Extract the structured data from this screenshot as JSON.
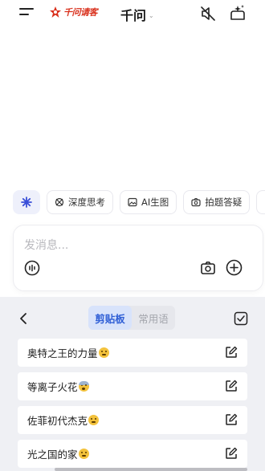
{
  "header": {
    "brand_text": "千问请客",
    "title": "千问",
    "title_caret": "⌄"
  },
  "chips": [
    {
      "icon": "sparkle-star-icon",
      "label": ""
    },
    {
      "icon": "deep-think-icon",
      "label": "深度思考"
    },
    {
      "icon": "image-gen-icon",
      "label": "AI生图"
    },
    {
      "icon": "camera-question-icon",
      "label": "拍题答疑"
    }
  ],
  "input": {
    "placeholder": "发消息..."
  },
  "clipboard": {
    "tabs": [
      {
        "label": "剪贴板",
        "active": true
      },
      {
        "label": "常用语",
        "active": false
      }
    ],
    "items": [
      {
        "text": "奥特之王的力量",
        "emoji": "thinking"
      },
      {
        "text": "等离子火花",
        "emoji": "fearful"
      },
      {
        "text": "佐菲初代杰克",
        "emoji": "thinking"
      },
      {
        "text": "光之国的家",
        "emoji": "thinking"
      }
    ]
  },
  "colors": {
    "accent": "#2f5fd6",
    "brand_red": "#d9301c",
    "panel_bg": "#eff0f4"
  }
}
